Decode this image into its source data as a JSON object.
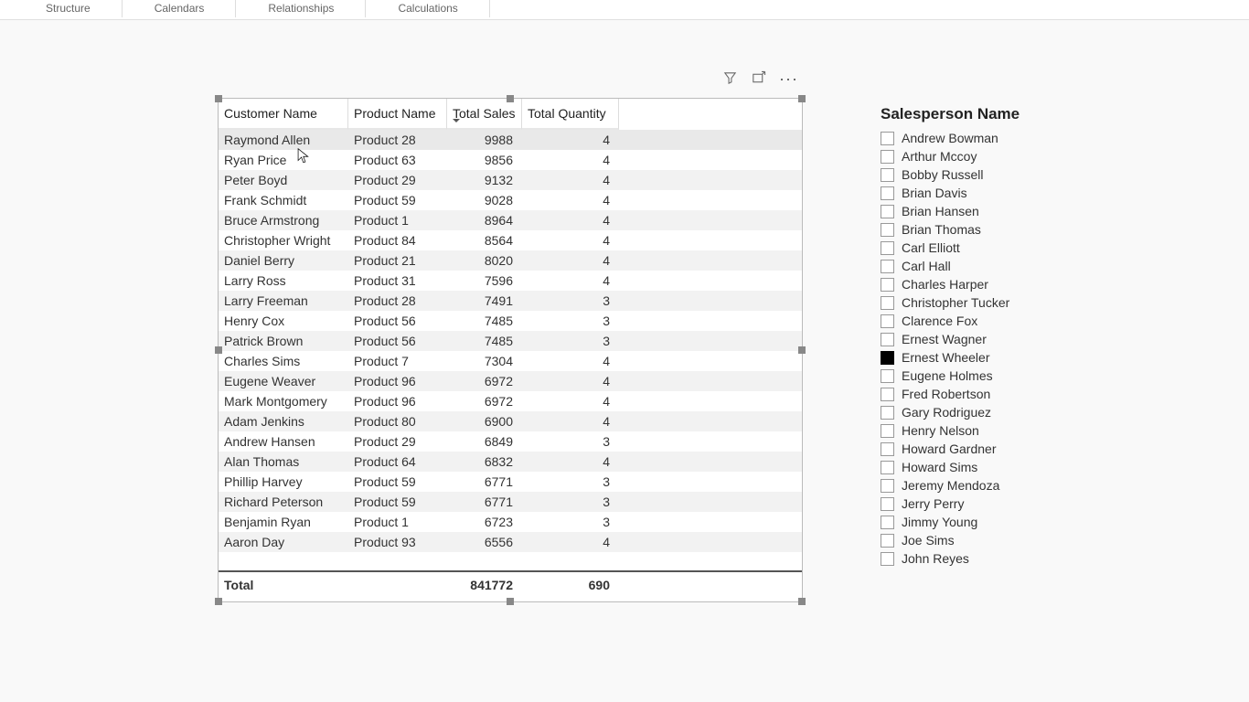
{
  "ribbon": {
    "groups": [
      "Structure",
      "Calendars",
      "Relationships",
      "Calculations"
    ]
  },
  "table": {
    "headers": {
      "customer": "Customer Name",
      "product": "Product Name",
      "sales": "Total Sales",
      "quantity": "Total Quantity"
    },
    "rows": [
      {
        "customer": "Raymond Allen",
        "product": "Product 28",
        "sales": "9988",
        "qty": "4"
      },
      {
        "customer": "Ryan Price",
        "product": "Product 63",
        "sales": "9856",
        "qty": "4"
      },
      {
        "customer": "Peter Boyd",
        "product": "Product 29",
        "sales": "9132",
        "qty": "4"
      },
      {
        "customer": "Frank Schmidt",
        "product": "Product 59",
        "sales": "9028",
        "qty": "4"
      },
      {
        "customer": "Bruce Armstrong",
        "product": "Product 1",
        "sales": "8964",
        "qty": "4"
      },
      {
        "customer": "Christopher Wright",
        "product": "Product 84",
        "sales": "8564",
        "qty": "4"
      },
      {
        "customer": "Daniel Berry",
        "product": "Product 21",
        "sales": "8020",
        "qty": "4"
      },
      {
        "customer": "Larry Ross",
        "product": "Product 31",
        "sales": "7596",
        "qty": "4"
      },
      {
        "customer": "Larry Freeman",
        "product": "Product 28",
        "sales": "7491",
        "qty": "3"
      },
      {
        "customer": "Henry Cox",
        "product": "Product 56",
        "sales": "7485",
        "qty": "3"
      },
      {
        "customer": "Patrick Brown",
        "product": "Product 56",
        "sales": "7485",
        "qty": "3"
      },
      {
        "customer": "Charles Sims",
        "product": "Product 7",
        "sales": "7304",
        "qty": "4"
      },
      {
        "customer": "Eugene Weaver",
        "product": "Product 96",
        "sales": "6972",
        "qty": "4"
      },
      {
        "customer": "Mark Montgomery",
        "product": "Product 96",
        "sales": "6972",
        "qty": "4"
      },
      {
        "customer": "Adam Jenkins",
        "product": "Product 80",
        "sales": "6900",
        "qty": "4"
      },
      {
        "customer": "Andrew Hansen",
        "product": "Product 29",
        "sales": "6849",
        "qty": "3"
      },
      {
        "customer": "Alan Thomas",
        "product": "Product 64",
        "sales": "6832",
        "qty": "4"
      },
      {
        "customer": "Phillip Harvey",
        "product": "Product 59",
        "sales": "6771",
        "qty": "3"
      },
      {
        "customer": "Richard Peterson",
        "product": "Product 59",
        "sales": "6771",
        "qty": "3"
      },
      {
        "customer": "Benjamin Ryan",
        "product": "Product 1",
        "sales": "6723",
        "qty": "3"
      },
      {
        "customer": "Aaron Day",
        "product": "Product 93",
        "sales": "6556",
        "qty": "4"
      }
    ],
    "total": {
      "label": "Total",
      "sales": "841772",
      "qty": "690"
    }
  },
  "slicer": {
    "title": "Salesperson Name",
    "items": [
      {
        "name": "Andrew Bowman",
        "checked": false
      },
      {
        "name": "Arthur Mccoy",
        "checked": false
      },
      {
        "name": "Bobby Russell",
        "checked": false
      },
      {
        "name": "Brian Davis",
        "checked": false
      },
      {
        "name": "Brian Hansen",
        "checked": false
      },
      {
        "name": "Brian Thomas",
        "checked": false
      },
      {
        "name": "Carl Elliott",
        "checked": false
      },
      {
        "name": "Carl Hall",
        "checked": false
      },
      {
        "name": "Charles Harper",
        "checked": false
      },
      {
        "name": "Christopher Tucker",
        "checked": false
      },
      {
        "name": "Clarence Fox",
        "checked": false
      },
      {
        "name": "Ernest Wagner",
        "checked": false
      },
      {
        "name": "Ernest Wheeler",
        "checked": true
      },
      {
        "name": "Eugene Holmes",
        "checked": false
      },
      {
        "name": "Fred Robertson",
        "checked": false
      },
      {
        "name": "Gary Rodriguez",
        "checked": false
      },
      {
        "name": "Henry Nelson",
        "checked": false
      },
      {
        "name": "Howard Gardner",
        "checked": false
      },
      {
        "name": "Howard Sims",
        "checked": false
      },
      {
        "name": "Jeremy Mendoza",
        "checked": false
      },
      {
        "name": "Jerry Perry",
        "checked": false
      },
      {
        "name": "Jimmy Young",
        "checked": false
      },
      {
        "name": "Joe Sims",
        "checked": false
      },
      {
        "name": "John Reyes",
        "checked": false
      }
    ]
  }
}
